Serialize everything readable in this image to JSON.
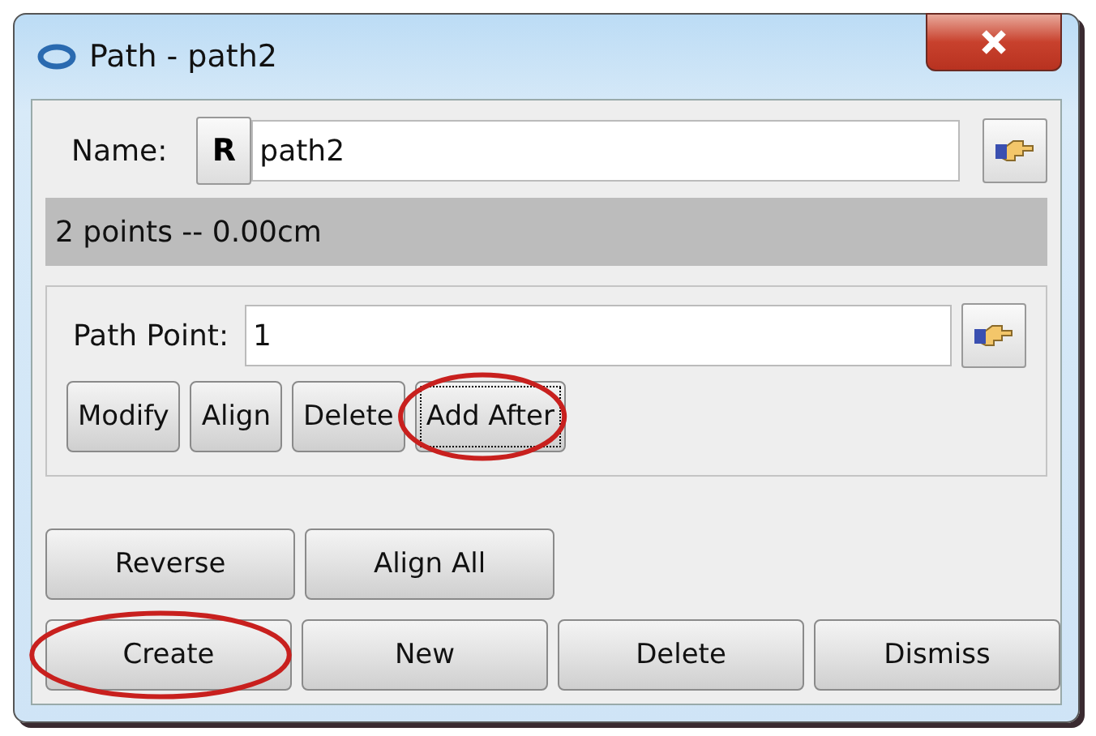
{
  "window": {
    "title": "Path - path2"
  },
  "name": {
    "label": "Name:",
    "mode_button": "R",
    "value": "path2"
  },
  "info": "2 points -- 0.00cm",
  "point": {
    "label": "Path Point:",
    "value": "1",
    "buttons": [
      {
        "label": "Modify",
        "focused": false,
        "circled": false
      },
      {
        "label": "Align",
        "focused": false,
        "circled": false
      },
      {
        "label": "Delete",
        "focused": false,
        "circled": false
      },
      {
        "label": "Add After",
        "focused": true,
        "circled": true
      }
    ]
  },
  "actions": [
    {
      "label": "Reverse"
    },
    {
      "label": "Align All"
    }
  ],
  "footer_buttons": [
    {
      "label": "Create",
      "circled": true
    },
    {
      "label": "New",
      "circled": false
    },
    {
      "label": "Delete",
      "circled": false
    },
    {
      "label": "Dismiss",
      "circled": false
    }
  ]
}
